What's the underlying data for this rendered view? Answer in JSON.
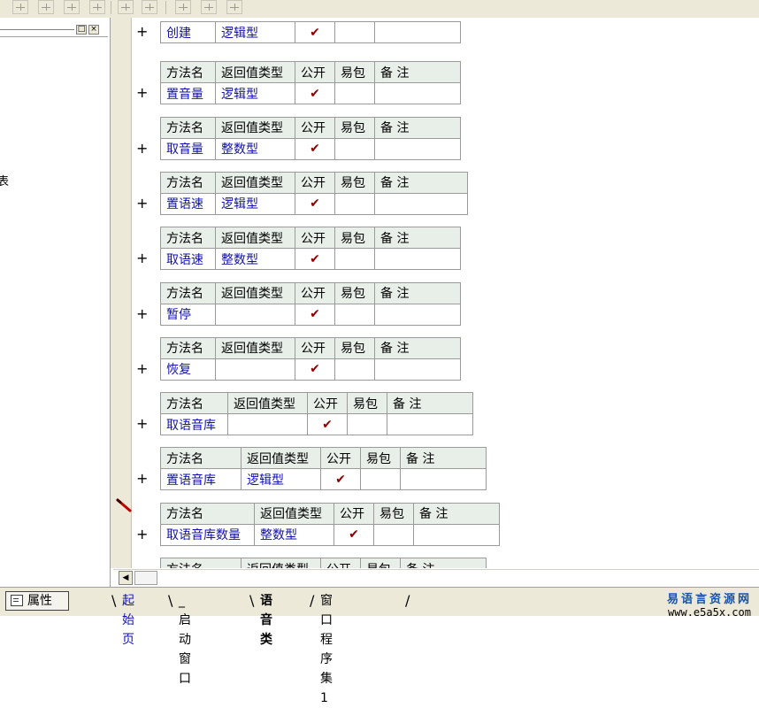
{
  "left_panel": {
    "cut_text": "表",
    "min_button": "□",
    "close_button": "×"
  },
  "methods": [
    {
      "name": "创建",
      "type": "逻辑型",
      "public": true,
      "partial_top": true
    },
    {
      "name": "置音量",
      "type": "逻辑型",
      "public": true
    },
    {
      "name": "取音量",
      "type": "整数型",
      "public": true
    },
    {
      "name": "置语速",
      "type": "逻辑型",
      "public": true
    },
    {
      "name": "取语速",
      "type": "整数型",
      "public": true
    },
    {
      "name": "暂停",
      "type": "",
      "public": true
    },
    {
      "name": "恢复",
      "type": "",
      "public": true
    },
    {
      "name": "取语音库",
      "type": "",
      "public": true
    },
    {
      "name": "置语音库",
      "type": "逻辑型",
      "public": true
    },
    {
      "name": "取语音库数量",
      "type": "整数型",
      "public": true,
      "cursor": true
    },
    {
      "name": "",
      "type": "",
      "public": false,
      "partial_bottom": true
    }
  ],
  "table_headers": {
    "name": "方法名",
    "return_type": "返回值类型",
    "public": "公开",
    "easy_pkg": "易包",
    "note": "备 注"
  },
  "plus_symbol": "+",
  "check_symbol": "✔",
  "status_bar": {
    "properties_button": "属性",
    "tabs": [
      {
        "label": "起始页",
        "style": "link"
      },
      {
        "label": "_启动窗口",
        "style": "normal"
      },
      {
        "label": "语音类",
        "style": "active"
      },
      {
        "label": "窗口程序集1",
        "style": "normal"
      }
    ],
    "watermark_cn": "易语言资源网",
    "watermark_url": "www.e5a5x.com"
  }
}
